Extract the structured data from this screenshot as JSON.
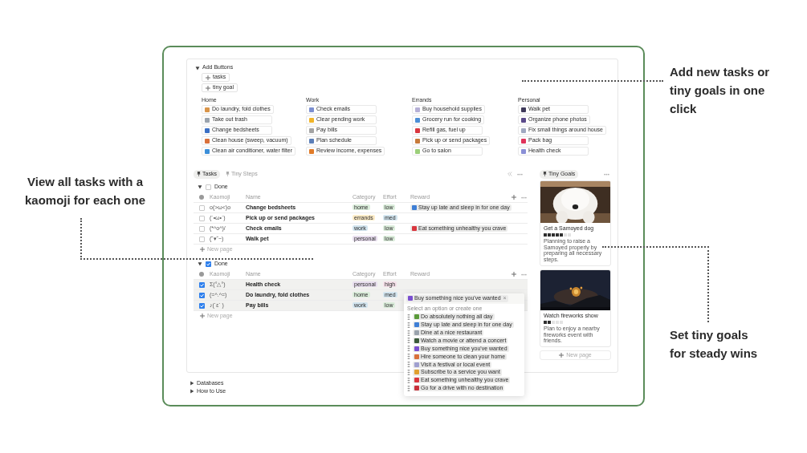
{
  "callouts": [
    {
      "lines": [
        "View all tasks with a",
        "kaomoji for each one"
      ]
    },
    {
      "lines": [
        "Add new tasks or",
        "tiny goals in one",
        "click"
      ]
    },
    {
      "lines": [
        "Set tiny goals",
        "for steady wins"
      ]
    }
  ],
  "add_buttons": {
    "title": "Add Buttons",
    "expanded": true,
    "buttons": [
      {
        "label": "tasks"
      },
      {
        "label": "tiny goal"
      }
    ]
  },
  "button_groups": [
    {
      "heading": "Home",
      "items": [
        {
          "label": "Do laundry, fold clothes",
          "color": "#d9954a"
        },
        {
          "label": "Take out trash",
          "color": "#9aa3ad"
        },
        {
          "label": "Change bedsheets",
          "color": "#3a6fc4"
        },
        {
          "label": "Clean house (sweep, vacuum)",
          "color": "#d9703a"
        },
        {
          "label": "Clean air conditioner, water filter",
          "color": "#3b8fd9"
        }
      ]
    },
    {
      "heading": "Work",
      "items": [
        {
          "label": "Check emails",
          "color": "#7c8fd0"
        },
        {
          "label": "Clear pending work",
          "color": "#f0b429"
        },
        {
          "label": "Pay bills",
          "color": "#a3a3a3"
        },
        {
          "label": "Plan schedule",
          "color": "#5c7fb8"
        },
        {
          "label": "Review income, expenses",
          "color": "#e07b28"
        }
      ]
    },
    {
      "heading": "Errands",
      "items": [
        {
          "label": "Buy household supplies",
          "color": "#b6b0d6"
        },
        {
          "label": "Grocery run for cooking",
          "color": "#4d8fd6"
        },
        {
          "label": "Refill gas, fuel up",
          "color": "#d9363e"
        },
        {
          "label": "Pick up or send packages",
          "color": "#c77a3a"
        },
        {
          "label": "Go to salon",
          "color": "#9ccf7a"
        }
      ]
    },
    {
      "heading": "Personal",
      "items": [
        {
          "label": "Walk pet",
          "color": "#3f3a5a"
        },
        {
          "label": "Organize phone photos",
          "color": "#5a4a8a"
        },
        {
          "label": "Fix small things around house",
          "color": "#a0a8c0"
        },
        {
          "label": "Pack bag",
          "color": "#e0335a"
        },
        {
          "label": "Health check",
          "color": "#8a8fd6"
        }
      ]
    }
  ],
  "tabs": [
    {
      "label": "Tasks",
      "selected": true
    },
    {
      "label": "Tiny Steps",
      "selected": false
    }
  ],
  "groups": [
    {
      "label": "Done",
      "checked": false,
      "expanded": true,
      "columns": [
        "Kaomoji",
        "Name",
        "Category",
        "Effort",
        "Reward"
      ],
      "new_page": "New page",
      "rows": [
        {
          "checked": false,
          "selected": false,
          "kaomoji": "o(>ω<)o",
          "name": "Change bedsheets",
          "category": {
            "label": "home",
            "color": "#dbeddb"
          },
          "effort": {
            "label": "low",
            "color": "#dbeddb"
          },
          "reward": {
            "label": "Stay up late and sleep in for one day",
            "color": "#3f7fd6"
          }
        },
        {
          "checked": false,
          "selected": false,
          "kaomoji": "(´•ω•`)",
          "name": "Pick up or send packages",
          "category": {
            "label": "errands",
            "color": "#fdecc8"
          },
          "effort": {
            "label": "med",
            "color": "#d3e5ef"
          }
        },
        {
          "checked": false,
          "selected": false,
          "kaomoji": "(*^o^)/",
          "name": "Check emails",
          "category": {
            "label": "work",
            "color": "#d3e5ef"
          },
          "effort": {
            "label": "low",
            "color": "#dbeddb"
          },
          "reward": {
            "label": "Eat something unhealthy you crave",
            "color": "#d9363e"
          }
        },
        {
          "checked": false,
          "selected": false,
          "kaomoji": "(˘▾˘~)",
          "name": "Walk pet",
          "category": {
            "label": "personal",
            "color": "#e8deee"
          },
          "effort": {
            "label": "low",
            "color": "#dbeddb"
          }
        }
      ]
    },
    {
      "label": "Done",
      "checked": true,
      "expanded": true,
      "columns": [
        "Kaomoji",
        "Name",
        "Category",
        "Effort",
        "Reward"
      ],
      "new_page": "New page",
      "rows": [
        {
          "checked": true,
          "selected": true,
          "kaomoji": "Σ(°△°)",
          "name": "Health check",
          "category": {
            "label": "personal",
            "color": "#e8deee"
          },
          "effort": {
            "label": "high",
            "color": "#f5e0e9"
          }
        },
        {
          "checked": true,
          "selected": true,
          "kaomoji": "(=^.^=)",
          "name": "Do laundry, fold clothes",
          "category": {
            "label": "home",
            "color": "#dbeddb"
          },
          "effort": {
            "label": "med",
            "color": "#d3e5ef"
          }
        },
        {
          "checked": true,
          "selected": true,
          "kaomoji": "♪(´ε` )",
          "name": "Pay bills",
          "category": {
            "label": "work",
            "color": "#d3e5ef"
          },
          "effort": {
            "label": "low",
            "color": "#dbeddb"
          }
        }
      ]
    }
  ],
  "reward_dropdown": {
    "value": {
      "label": "Buy something nice you've wanted",
      "color": "#7a4fd0"
    },
    "remove": "×",
    "hint": "Select an option or create one",
    "options": [
      {
        "label": "Do absolutely nothing all day",
        "color": "#5a9a3a"
      },
      {
        "label": "Stay up late and sleep in for one day",
        "color": "#3f7fd6"
      },
      {
        "label": "Dine at a nice restaurant",
        "color": "#9aa3ad"
      },
      {
        "label": "Watch a movie or attend a concert",
        "color": "#3a5a3a"
      },
      {
        "label": "Buy something nice you've wanted",
        "color": "#7a4fd0"
      },
      {
        "label": "Hire someone to clean your home",
        "color": "#d9703a"
      },
      {
        "label": "Visit a festival or local event",
        "color": "#a0a0d0"
      },
      {
        "label": "Subscribe to a service you want",
        "color": "#e0a030"
      },
      {
        "label": "Eat something unhealthy you crave",
        "color": "#d9363e"
      },
      {
        "label": "Go for a drive with no destination",
        "color": "#c8303a"
      }
    ]
  },
  "gallery": {
    "tab": "Tiny Goals",
    "cards": [
      {
        "kind": "dog",
        "title": "Get a Samoyed dog",
        "stars": 5,
        "description": "Planning to raise a Samoyed properly by preparing all necessary steps."
      },
      {
        "kind": "fireworks",
        "title": "Watch fireworks show",
        "stars": 2,
        "description": "Plan to enjoy a nearby fireworks event with friends."
      }
    ],
    "new_page": "New page"
  },
  "footer_toggles": [
    {
      "label": "Databases",
      "expanded": false
    },
    {
      "label": "How to Use",
      "expanded": false
    }
  ]
}
